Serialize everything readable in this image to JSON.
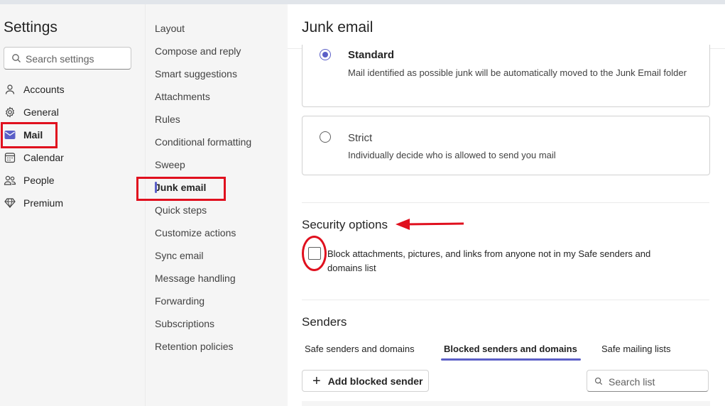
{
  "settings": {
    "title": "Settings",
    "search_placeholder": "Search settings",
    "nav": [
      {
        "label": "Accounts",
        "icon": "person-icon"
      },
      {
        "label": "General",
        "icon": "gear-icon"
      },
      {
        "label": "Mail",
        "icon": "mail-icon",
        "active": true
      },
      {
        "label": "Calendar",
        "icon": "calendar-icon"
      },
      {
        "label": "People",
        "icon": "people-icon"
      },
      {
        "label": "Premium",
        "icon": "diamond-icon"
      }
    ]
  },
  "mail_nav": [
    {
      "label": "Layout"
    },
    {
      "label": "Compose and reply"
    },
    {
      "label": "Smart suggestions"
    },
    {
      "label": "Attachments"
    },
    {
      "label": "Rules"
    },
    {
      "label": "Conditional formatting"
    },
    {
      "label": "Sweep"
    },
    {
      "label": "Junk email",
      "active": true
    },
    {
      "label": "Quick steps"
    },
    {
      "label": "Customize actions"
    },
    {
      "label": "Sync email"
    },
    {
      "label": "Message handling"
    },
    {
      "label": "Forwarding"
    },
    {
      "label": "Subscriptions"
    },
    {
      "label": "Retention policies"
    }
  ],
  "main": {
    "title": "Junk email",
    "filter_options": [
      {
        "title": "Standard",
        "description": "Mail identified as possible junk will be automatically moved to the Junk Email folder",
        "selected": true
      },
      {
        "title": "Strict",
        "description": "Individually decide who is allowed to send you mail",
        "selected": false
      }
    ],
    "security": {
      "title": "Security options",
      "checkbox_label": "Block attachments, pictures, and links from anyone not in my Safe senders and domains list",
      "checked": false
    },
    "senders": {
      "title": "Senders",
      "tabs": [
        {
          "label": "Safe senders and domains"
        },
        {
          "label": "Blocked senders and domains",
          "active": true
        },
        {
          "label": "Safe mailing lists"
        }
      ],
      "add_button": "Add blocked sender",
      "search_placeholder": "Search list"
    }
  },
  "colors": {
    "accent": "#5b5fc7",
    "annotation": "#e0101e"
  }
}
